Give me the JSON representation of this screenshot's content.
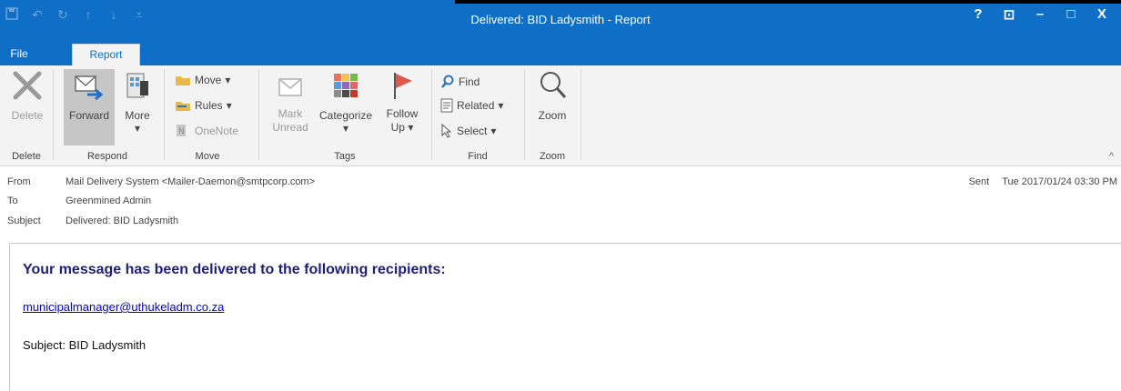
{
  "window": {
    "title": "Delivered: BID Ladysmith - Report",
    "qat_icons": [
      "save-icon",
      "undo-icon",
      "redo-icon",
      "up-arrow-icon",
      "down-arrow-icon",
      "customize-qat-icon"
    ],
    "controls": {
      "help": "?",
      "ribbon_display": "⊡",
      "minimize": "–",
      "maximize": "□",
      "close": "X"
    }
  },
  "tabs": [
    {
      "label": "File"
    },
    {
      "label": "Report"
    }
  ],
  "ribbon": {
    "groups": {
      "delete": "Delete",
      "respond": "Respond",
      "move": "Move",
      "tags": "Tags",
      "find": "Find",
      "zoom": "Zoom"
    },
    "delete_label": "Delete",
    "forward_label": "Forward",
    "more_label": "More",
    "more_arrow": "▾",
    "move_label": "Move",
    "rules_label": "Rules",
    "onenote_label": "OneNote",
    "mark_unread_line1": "Mark",
    "mark_unread_line2": "Unread",
    "categorize_label": "Categorize",
    "categorize_arrow": "▾",
    "follow_up_line1": "Follow",
    "follow_up_line2": "Up",
    "find_label": "Find",
    "related_label": "Related",
    "select_label": "Select",
    "zoom_label": "Zoom",
    "dropdown_arrow": "▾",
    "collapse_arrow": "^"
  },
  "header": {
    "from_key": "From",
    "from_value": "Mail Delivery System <Mailer-Daemon@smtpcorp.com>",
    "to_key": "To",
    "to_value": "Greenmined Admin",
    "subject_key": "Subject",
    "subject_value": "Delivered: BID Ladysmith",
    "sent_key": "Sent",
    "sent_value": "Tue 2017/01/24 03:30 PM"
  },
  "body": {
    "heading": "Your message has been delivered to the following recipients:",
    "recipient": "municipalmanager@uthukeladm.co.za",
    "subject_line": "Subject: BID Ladysmith"
  }
}
